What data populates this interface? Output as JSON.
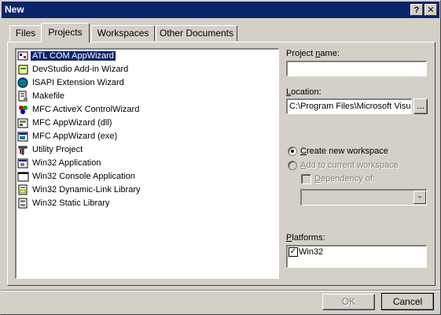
{
  "window": {
    "title": "New",
    "help_label": "?",
    "close_label": "✕"
  },
  "tabs": [
    {
      "label": "Files"
    },
    {
      "label": "Projects"
    },
    {
      "label": "Workspaces"
    },
    {
      "label": "Other Documents"
    }
  ],
  "active_tab": "Projects",
  "projects": [
    {
      "label": "ATL COM AppWizard",
      "icon": "atl-icon"
    },
    {
      "label": "DevStudio Add-in Wizard",
      "icon": "devstudio-addin-icon"
    },
    {
      "label": "ISAPI Extension Wizard",
      "icon": "isapi-icon"
    },
    {
      "label": "Makefile",
      "icon": "makefile-icon"
    },
    {
      "label": "MFC ActiveX ControlWizard",
      "icon": "activex-icon"
    },
    {
      "label": "MFC AppWizard (dll)",
      "icon": "mfc-dll-icon"
    },
    {
      "label": "MFC AppWizard (exe)",
      "icon": "mfc-exe-icon"
    },
    {
      "label": "Utility Project",
      "icon": "utility-icon"
    },
    {
      "label": "Win32 Application",
      "icon": "win32-app-icon"
    },
    {
      "label": "Win32 Console Application",
      "icon": "console-icon"
    },
    {
      "label": "Win32 Dynamic-Link Library",
      "icon": "dll-icon"
    },
    {
      "label": "Win32 Static Library",
      "icon": "static-lib-icon"
    }
  ],
  "selected_project": "ATL COM AppWizard",
  "project_name": {
    "label_pre": "Project ",
    "label_u": "n",
    "label_post": "ame:",
    "value": ""
  },
  "location": {
    "label_pre": "",
    "label_u": "L",
    "label_post": "ocation:",
    "value": "C:\\Program Files\\Microsoft Visua",
    "browse_label": "..."
  },
  "workspace": {
    "create_pre": "",
    "create_u": "C",
    "create_post": "reate new workspace",
    "add_pre": "",
    "add_u": "A",
    "add_post": "dd to current workspace",
    "dependency_pre": "",
    "dependency_u": "D",
    "dependency_post": "ependency of:",
    "selected": "create"
  },
  "platforms": {
    "label_pre": "",
    "label_u": "P",
    "label_post": "latforms:",
    "items": [
      {
        "label": "Win32",
        "checked": true
      }
    ]
  },
  "buttons": {
    "ok": "OK",
    "cancel": "Cancel"
  },
  "colors": {
    "face": "#d4d0c8",
    "selection": "#0a246a",
    "title_bar": "#0a246a"
  }
}
